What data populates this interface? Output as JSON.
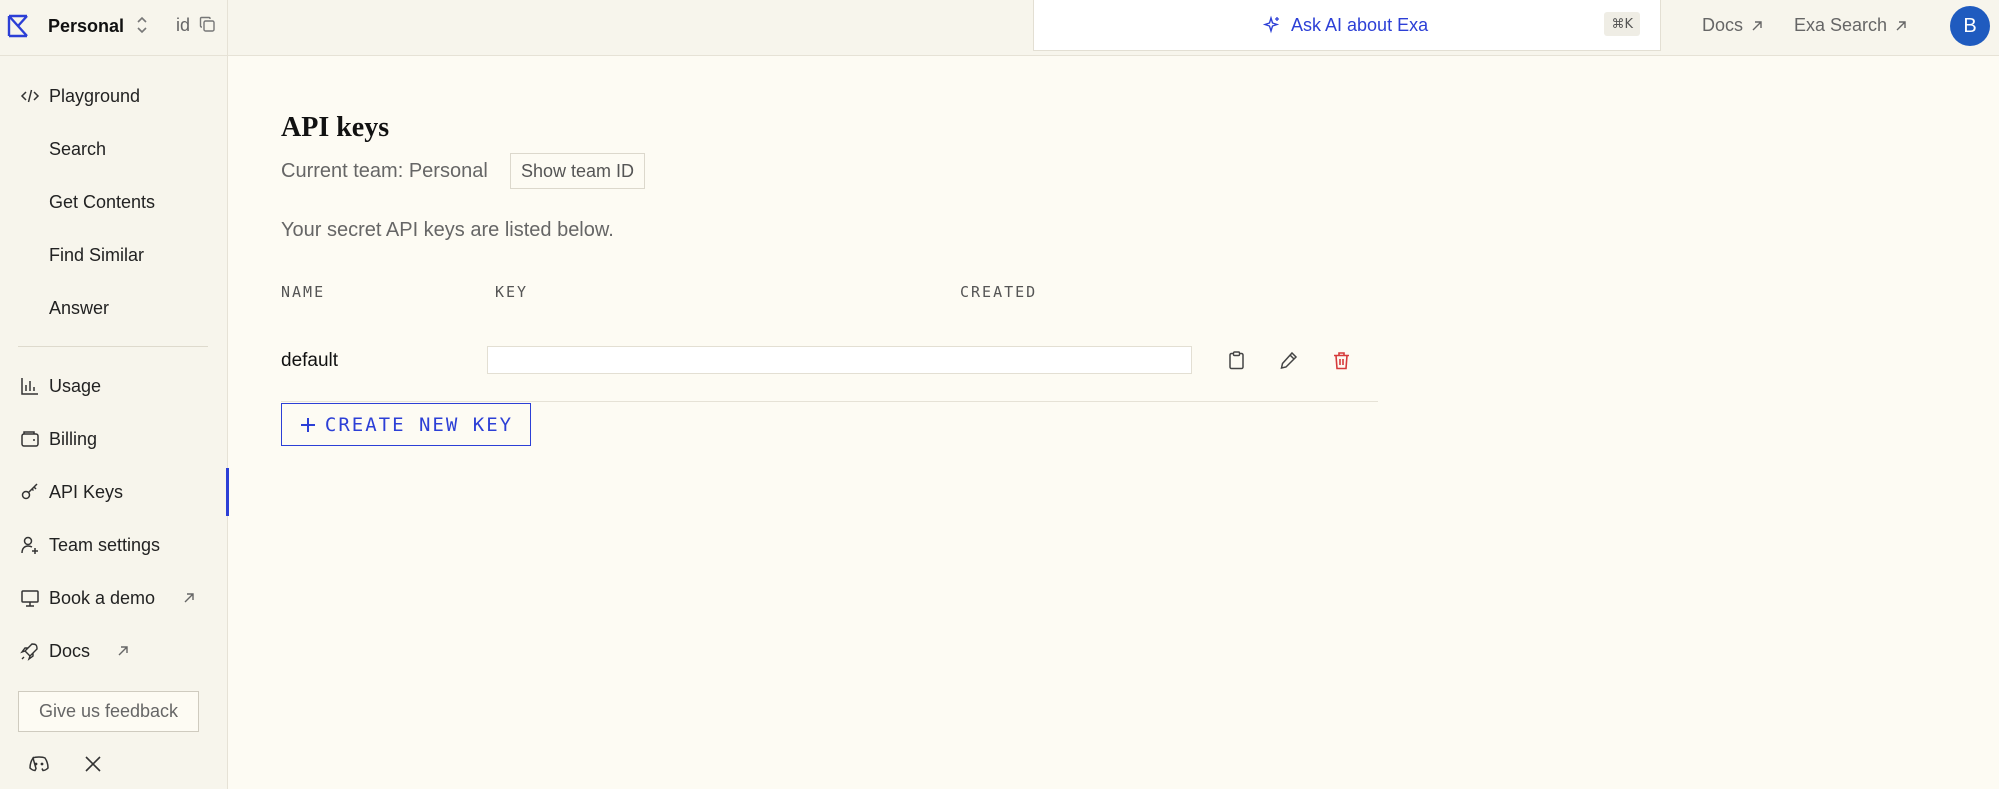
{
  "team": {
    "name": "Personal",
    "id_label": "id"
  },
  "topbar": {
    "ask_label": "Ask AI about Exa",
    "shortcut": "⌘K",
    "links": [
      {
        "label": "Docs"
      },
      {
        "label": "Exa Search"
      }
    ],
    "avatar_initial": "B",
    "avatar_color": "#1f5bbf"
  },
  "sidebar": {
    "items": [
      {
        "label": "Playground",
        "icon": "code-icon"
      },
      {
        "label": "Search"
      },
      {
        "label": "Get Contents"
      },
      {
        "label": "Find Similar"
      },
      {
        "label": "Answer"
      },
      {
        "label": "Usage",
        "icon": "bar-chart-icon"
      },
      {
        "label": "Billing",
        "icon": "wallet-icon"
      },
      {
        "label": "API Keys",
        "icon": "key-icon",
        "active": true
      },
      {
        "label": "Team settings",
        "icon": "user-plus-icon"
      },
      {
        "label": "Book a demo",
        "icon": "presentation-icon",
        "external": true
      },
      {
        "label": "Docs",
        "icon": "rocket-icon",
        "external": true
      }
    ],
    "feedback_label": "Give us feedback"
  },
  "main": {
    "title": "API keys",
    "current_team": "Current team: Personal",
    "show_team_id": "Show team ID",
    "description": "Your secret API keys are listed below.",
    "table": {
      "headers": [
        "NAME",
        "KEY",
        "CREATED"
      ],
      "rows": [
        {
          "name": "default",
          "key": "",
          "created": ""
        }
      ]
    },
    "create_label": "CREATE NEW KEY"
  },
  "colors": {
    "accent": "#2c3fd6",
    "danger": "#d63a3a",
    "background": "#fdfbf3",
    "sidebar": "#f7f5ec"
  }
}
